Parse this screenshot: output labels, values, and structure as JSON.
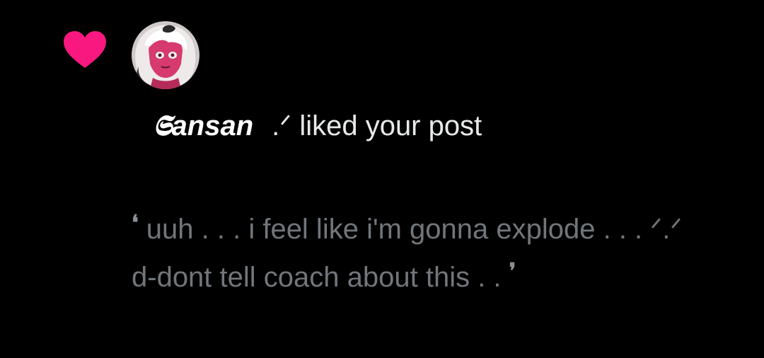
{
  "notification": {
    "icon": "heart-icon",
    "accent_color": "#f91880",
    "user": {
      "display_name": "𝕾ansan",
      "name_suffix": ".ᐟ"
    },
    "action_text": "liked your post",
    "post_preview": {
      "open_quote": "❛",
      "line1": "uuh . . . i feel like i'm gonna explode . . . ᐟ.ᐟ",
      "line2": "d-dont tell coach about this . .",
      "close_quote": "❜"
    }
  }
}
